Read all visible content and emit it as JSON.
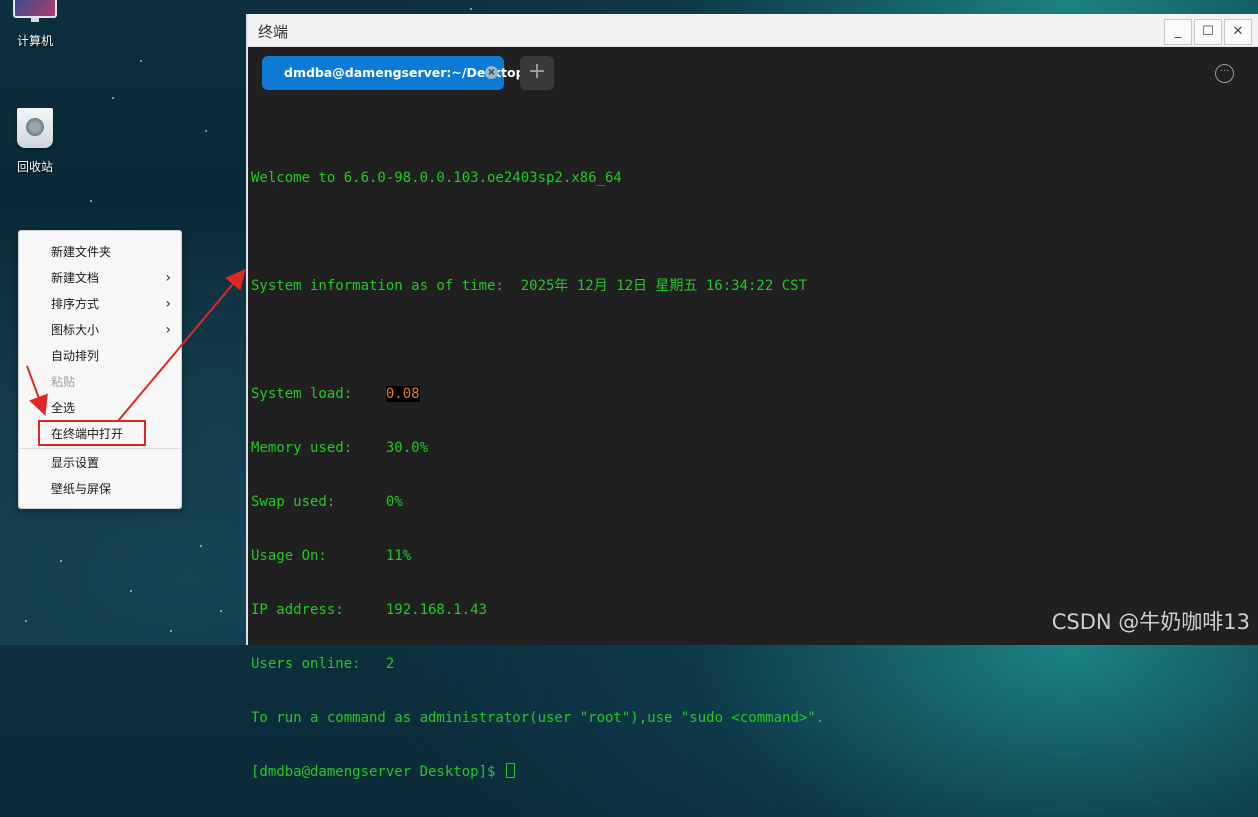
{
  "desktop": {
    "icons": [
      {
        "label": "计算机"
      },
      {
        "label": "回收站"
      }
    ]
  },
  "context_menu": {
    "items": [
      {
        "label": "新建文件夹",
        "submenu": false,
        "disabled": false
      },
      {
        "label": "新建文档",
        "submenu": true,
        "disabled": false
      },
      {
        "label": "排序方式",
        "submenu": true,
        "disabled": false
      },
      {
        "label": "图标大小",
        "submenu": true,
        "disabled": false
      },
      {
        "label": "自动排列",
        "submenu": false,
        "disabled": false
      },
      {
        "label": "粘贴",
        "submenu": false,
        "disabled": true
      },
      {
        "label": "全选",
        "submenu": false,
        "disabled": false
      },
      {
        "label": "在终端中打开",
        "submenu": false,
        "disabled": false,
        "highlighted": true
      },
      {
        "label": "显示设置",
        "submenu": false,
        "disabled": false
      },
      {
        "label": "壁纸与屏保",
        "submenu": false,
        "disabled": false
      }
    ],
    "highlight_color": "#e02727"
  },
  "terminal": {
    "window_title": "终端",
    "tab_label": "dmdba@damengserver:~/Desktop",
    "tab_close": "×",
    "add_tab": "+",
    "more": "···",
    "text_color": "#23c823",
    "lines": {
      "welcome": "Welcome to 6.6.0-98.0.0.103.oe2403sp2.x86_64",
      "sysinfo": "System information as of time:  2025年 12月 12日 星期五 16:34:22 CST",
      "load_label": "System load:    ",
      "load_value": "0.08",
      "memory": "Memory used:    30.0%",
      "swap": "Swap used:      0%",
      "usage": "Usage On:       11%",
      "ip": "IP address:     192.168.1.43",
      "users": "Users online:   2",
      "sudo": "To run a command as administrator(user \"root\"),use \"sudo <command>\".",
      "prompt": "[dmdba@damengserver Desktop]$ "
    }
  },
  "watermark": "CSDN @牛奶咖啡13"
}
